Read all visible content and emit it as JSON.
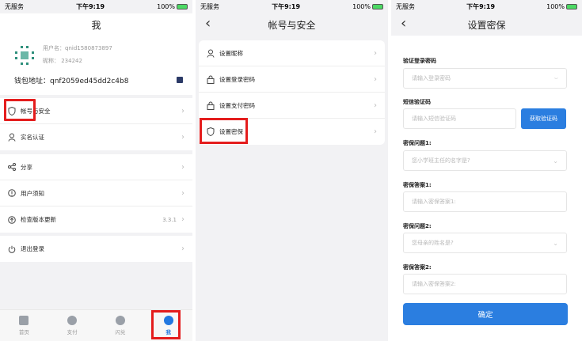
{
  "status": {
    "carrier": "无服务",
    "time": "下午9:19",
    "battery": "100%"
  },
  "screen1": {
    "title": "我",
    "username_label": "用户名：qnid1580873897",
    "nickname_label": "昵称：  234242",
    "wallet": "钱包地址：qnf2059ed45dd2c4b8",
    "menu_group1": [
      "帐号与安全",
      "实名认证"
    ],
    "menu_group2": [
      "分享",
      "用户须知",
      "检查版本更新"
    ],
    "version": "3.3.1",
    "logout": "退出登录",
    "tabs": [
      "首页",
      "支付",
      "闪兑",
      "我"
    ]
  },
  "screen2": {
    "title": "帐号与安全",
    "items": [
      "设置昵称",
      "设置登录密码",
      "设置支付密码",
      "设置密保"
    ]
  },
  "screen3": {
    "title": "设置密保",
    "login_pwd_label": "验证登录密码",
    "login_pwd_placeholder": "请输入登录密码",
    "sms_label": "短信验证码",
    "sms_placeholder": "请输入短信验证码",
    "sms_button": "获取验证码",
    "q1_label": "密保问题1:",
    "q1_value": "您小学班主任的名字是?",
    "a1_label": "密保答案1:",
    "a1_placeholder": "请输入密保答案1:",
    "q2_label": "密保问题2:",
    "q2_value": "您母亲的姓名是?",
    "a2_label": "密保答案2:",
    "a2_placeholder": "请输入密保答案2:",
    "confirm": "确定"
  },
  "colors": {
    "accent": "#2b7ee0",
    "highlight": "#e41d1d"
  }
}
